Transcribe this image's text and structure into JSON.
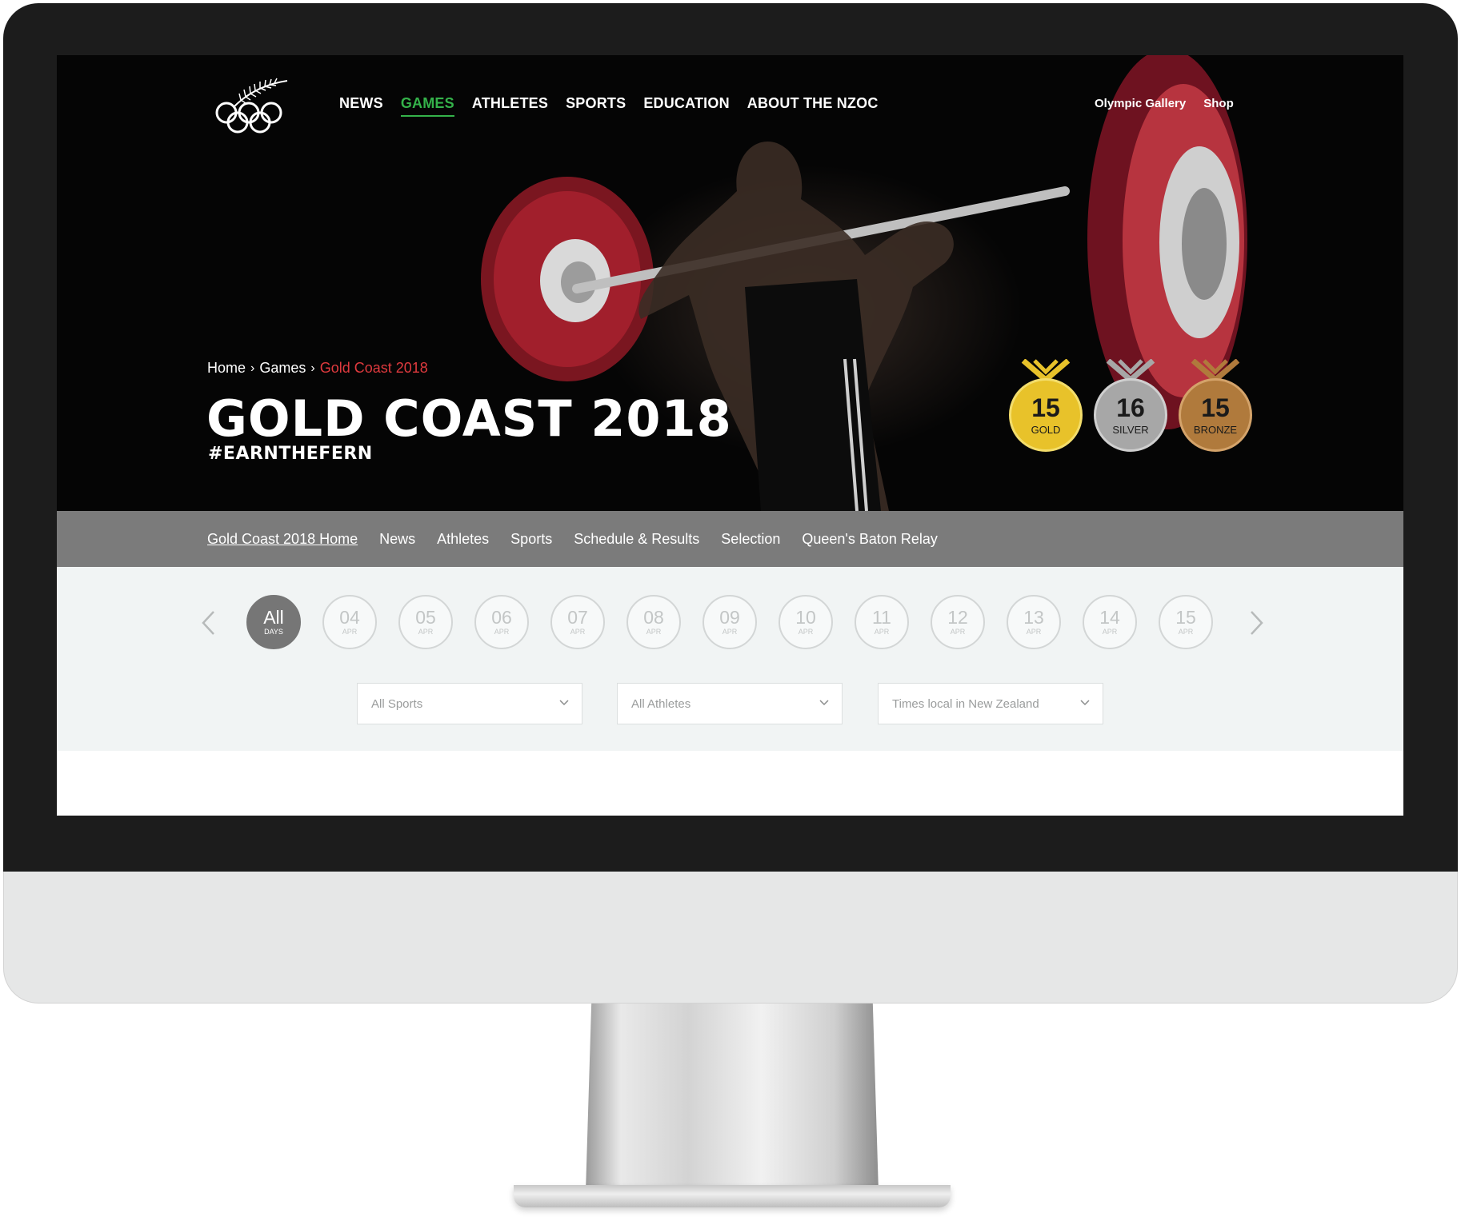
{
  "main_nav": {
    "items": [
      {
        "label": "NEWS",
        "active": false
      },
      {
        "label": "GAMES",
        "active": true
      },
      {
        "label": "ATHLETES",
        "active": false
      },
      {
        "label": "SPORTS",
        "active": false
      },
      {
        "label": "EDUCATION",
        "active": false
      },
      {
        "label": "ABOUT THE NZOC",
        "active": false
      }
    ]
  },
  "util_nav": {
    "items": [
      {
        "label": "Olympic Gallery"
      },
      {
        "label": "Shop"
      }
    ]
  },
  "breadcrumb": {
    "home": "Home",
    "games": "Games",
    "current": "Gold Coast 2018",
    "separator": "›"
  },
  "hero": {
    "title": "GOLD COAST 2018",
    "hashtag": "#EARNTHEFERN"
  },
  "medals": {
    "gold": {
      "count": "15",
      "label": "GOLD",
      "color": "#e8c22a"
    },
    "silver": {
      "count": "16",
      "label": "SILVER",
      "color": "#a7a7a7"
    },
    "bronze": {
      "count": "15",
      "label": "BRONZE",
      "color": "#b07a3c"
    }
  },
  "sub_nav": {
    "items": [
      {
        "label": "Gold Coast 2018 Home",
        "active": true
      },
      {
        "label": "News",
        "active": false
      },
      {
        "label": "Athletes",
        "active": false
      },
      {
        "label": "Sports",
        "active": false
      },
      {
        "label": "Schedule & Results",
        "active": false
      },
      {
        "label": "Selection",
        "active": false
      },
      {
        "label": "Queen's Baton Relay",
        "active": false
      }
    ]
  },
  "days": {
    "all": {
      "label": "All",
      "sub": "DAYS"
    },
    "items": [
      {
        "num": "04",
        "sub": "APR"
      },
      {
        "num": "05",
        "sub": "APR"
      },
      {
        "num": "06",
        "sub": "APR"
      },
      {
        "num": "07",
        "sub": "APR"
      },
      {
        "num": "08",
        "sub": "APR"
      },
      {
        "num": "09",
        "sub": "APR"
      },
      {
        "num": "10",
        "sub": "APR"
      },
      {
        "num": "11",
        "sub": "APR"
      },
      {
        "num": "12",
        "sub": "APR"
      },
      {
        "num": "13",
        "sub": "APR"
      },
      {
        "num": "14",
        "sub": "APR"
      },
      {
        "num": "15",
        "sub": "APR"
      }
    ]
  },
  "filters": {
    "sports": "All Sports",
    "athletes": "All Athletes",
    "timezone": "Times local in New Zealand"
  },
  "colors": {
    "accent_green": "#34b24a",
    "breadcrumb_red": "#e03a3e",
    "subnav_gray": "#7b7b7b"
  },
  "icons": [
    "fern-olympic-rings-logo",
    "chevron-left-icon",
    "chevron-right-icon",
    "chevron-down-icon"
  ]
}
